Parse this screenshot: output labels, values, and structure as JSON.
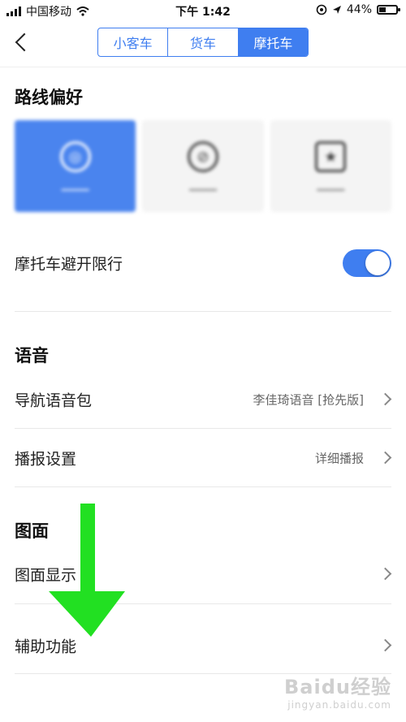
{
  "status_bar": {
    "carrier": "中国移动",
    "time": "下午 1:42",
    "battery": "44%",
    "battery_level": 0.44
  },
  "header": {
    "tabs": [
      {
        "label": "小客车",
        "active": false
      },
      {
        "label": "货车",
        "active": false
      },
      {
        "label": "摩托车",
        "active": true
      }
    ]
  },
  "route_preference": {
    "title": "路线偏好",
    "options": [
      {
        "icon": "smart-route-icon",
        "active": true
      },
      {
        "icon": "avoid-highway-icon",
        "active": false
      },
      {
        "icon": "scenic-route-icon",
        "active": false
      }
    ]
  },
  "motorcycle_restriction": {
    "label": "摩托车避开限行",
    "enabled": true
  },
  "voice": {
    "title": "语音",
    "nav_voice_pack": {
      "label": "导航语音包",
      "value": "李佳琦语音 [抢先版]"
    },
    "broadcast": {
      "label": "播报设置",
      "value": "详细播报"
    }
  },
  "map_view": {
    "title": "图面",
    "display": {
      "label": "图面显示"
    }
  },
  "accessibility": {
    "label": "辅助功能"
  },
  "watermark": {
    "brand": "Baidu",
    "brand_cn": "经验",
    "url": "jingyan.baidu.com"
  },
  "colors": {
    "accent": "#3f7ef0",
    "arrow": "#22e022"
  }
}
